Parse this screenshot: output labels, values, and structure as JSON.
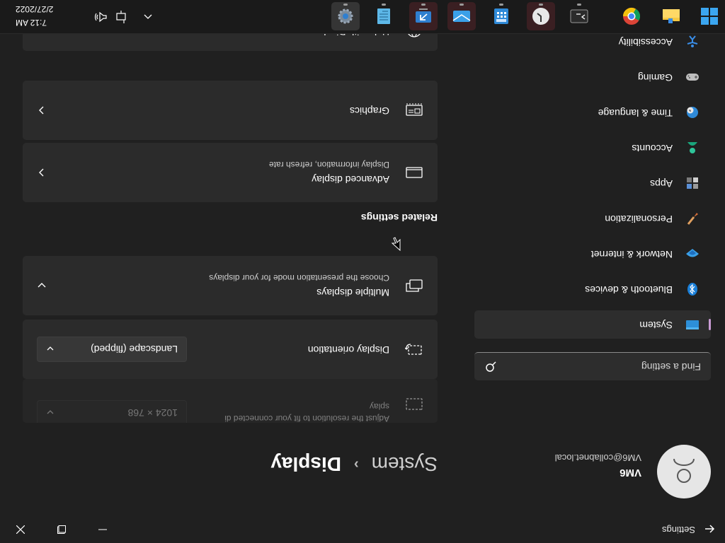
{
  "window": {
    "app_title": "Settings"
  },
  "user": {
    "name": "VM6",
    "email": "VM6@collabnet.local"
  },
  "search": {
    "placeholder": "Find a setting"
  },
  "nav": [
    {
      "label": "System",
      "icon": "system-icon",
      "selected": true
    },
    {
      "label": "Bluetooth & devices",
      "icon": "bluetooth-icon"
    },
    {
      "label": "Network & internet",
      "icon": "network-icon"
    },
    {
      "label": "Personalization",
      "icon": "brush-icon"
    },
    {
      "label": "Apps",
      "icon": "apps-icon"
    },
    {
      "label": "Accounts",
      "icon": "accounts-icon"
    },
    {
      "label": "Time & language",
      "icon": "globe-clock-icon"
    },
    {
      "label": "Gaming",
      "icon": "gamepad-icon"
    },
    {
      "label": "Accessibility",
      "icon": "accessibility-icon"
    }
  ],
  "breadcrumb": {
    "parent": "System",
    "separator": "›",
    "current": "Display"
  },
  "settings": {
    "resolution": {
      "subtitle_line1": "Adjust the resolution to fit your connected di",
      "subtitle_line2": "splay",
      "value": "1024 × 768"
    },
    "orientation": {
      "title": "Display orientation",
      "value": "Landscape (flipped)"
    },
    "multiple_displays": {
      "title": "Multiple displays",
      "subtitle": "Choose the presentation mode for your displays"
    },
    "related_title": "Related settings",
    "advanced_display": {
      "title": "Advanced display",
      "subtitle": "Display information, refresh rate"
    },
    "graphics": {
      "title": "Graphics"
    },
    "help": {
      "title": "Help with Display"
    }
  },
  "taskbar": {
    "apps": [
      {
        "name": "start-icon"
      },
      {
        "name": "file-explorer-icon"
      },
      {
        "name": "chrome-icon"
      },
      {
        "name": "terminal-icon"
      },
      {
        "name": "clock-app-icon"
      },
      {
        "name": "calculator-app-icon"
      },
      {
        "name": "mail-app-icon"
      },
      {
        "name": "remote-app-icon"
      },
      {
        "name": "notepad-icon"
      },
      {
        "name": "settings-gear-icon"
      }
    ],
    "time": "7:12 AM",
    "date": "2/27/2022"
  },
  "colors": {
    "accent": "#c99bd4",
    "background": "#202020",
    "card": "#2b2b2b"
  }
}
